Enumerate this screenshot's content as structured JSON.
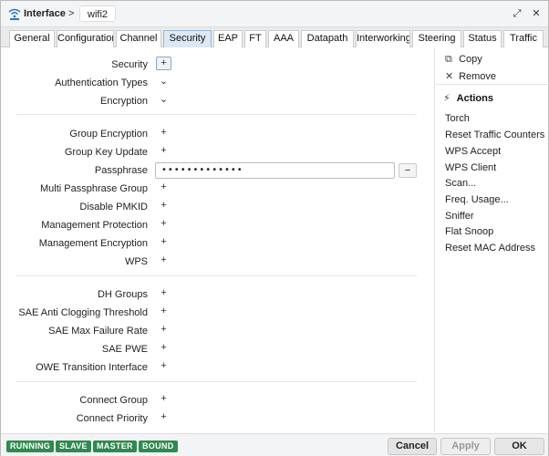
{
  "titlebar": {
    "title": "Interface",
    "separator": ">",
    "name": "wifi2",
    "restore_glyph": "⤢",
    "close_glyph": "✕"
  },
  "tabs": [
    {
      "label": "General",
      "active": false
    },
    {
      "label": "Configuration",
      "active": false
    },
    {
      "label": "Channel",
      "active": false
    },
    {
      "label": "Security",
      "active": true
    },
    {
      "label": "EAP",
      "active": false
    },
    {
      "label": "FT",
      "active": false
    },
    {
      "label": "AAA",
      "active": false
    },
    {
      "label": "Datapath",
      "active": false
    },
    {
      "label": "Interworking",
      "active": false
    },
    {
      "label": "Steering",
      "active": false
    },
    {
      "label": "Status",
      "active": false
    },
    {
      "label": "Traffic",
      "active": false
    }
  ],
  "form": {
    "rows": [
      {
        "label": "Security",
        "control": "+"
      },
      {
        "label": "Authentication Types",
        "control": "⌄"
      },
      {
        "label": "Encryption",
        "control": "⌄"
      },
      {
        "label": "Group Encryption",
        "control": "+"
      },
      {
        "label": "Group Key Update",
        "control": "+"
      },
      {
        "label": "Passphrase",
        "control": ""
      },
      {
        "label": "Multi Passphrase Group",
        "control": "+"
      },
      {
        "label": "Disable PMKID",
        "control": "+"
      },
      {
        "label": "Management Protection",
        "control": "+"
      },
      {
        "label": "Management Encryption",
        "control": "+"
      },
      {
        "label": "WPS",
        "control": "+"
      },
      {
        "label": "DH Groups",
        "control": "+"
      },
      {
        "label": "SAE Anti Clogging Threshold",
        "control": "+"
      },
      {
        "label": "SAE Max Failure Rate",
        "control": "+"
      },
      {
        "label": "SAE PWE",
        "control": "+"
      },
      {
        "label": "OWE Transition Interface",
        "control": "+"
      },
      {
        "label": "Connect Group",
        "control": "+"
      },
      {
        "label": "Connect Priority",
        "control": "+"
      }
    ],
    "passphrase_value": "•••••••••••••",
    "passphrase_remove": "−"
  },
  "panel": {
    "copy": "Copy",
    "remove": "Remove",
    "actions_heading": "Actions",
    "actions": [
      "Torch",
      "Reset Traffic Counters",
      "WPS Accept",
      "WPS Client",
      "Scan...",
      "Freq. Usage...",
      "Sniffer",
      "Flat Snoop",
      "Reset MAC Address"
    ]
  },
  "footer": {
    "badges": [
      "RUNNING",
      "SLAVE",
      "MASTER",
      "BOUND"
    ],
    "badge_color": "#2f8a4d",
    "cancel": "Cancel",
    "apply": "Apply",
    "ok": "OK"
  }
}
